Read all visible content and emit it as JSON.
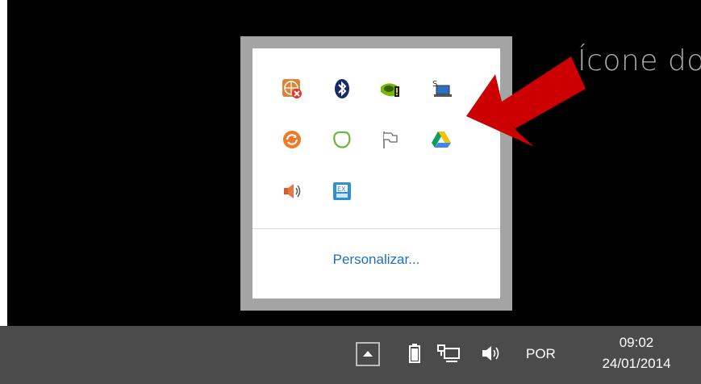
{
  "overflow_popup": {
    "icons": [
      {
        "name": "network-error-icon"
      },
      {
        "name": "bluetooth-icon"
      },
      {
        "name": "nvidia-icon"
      },
      {
        "name": "remote-connection-icon"
      },
      {
        "name": "sync-icon"
      },
      {
        "name": "evernote-icon"
      },
      {
        "name": "action-center-flag-icon"
      },
      {
        "name": "google-drive-icon"
      },
      {
        "name": "speaker-icon"
      },
      {
        "name": "keyboard-layout-icon"
      }
    ],
    "customize_label": "Personalizar..."
  },
  "annotation": {
    "text": "Ícone do",
    "color": "#a9a9a9",
    "arrow_color": "#cc0000"
  },
  "taskbar": {
    "language": "POR",
    "time": "09:02",
    "date": "24/01/2014",
    "background": "#4b4b4b"
  }
}
